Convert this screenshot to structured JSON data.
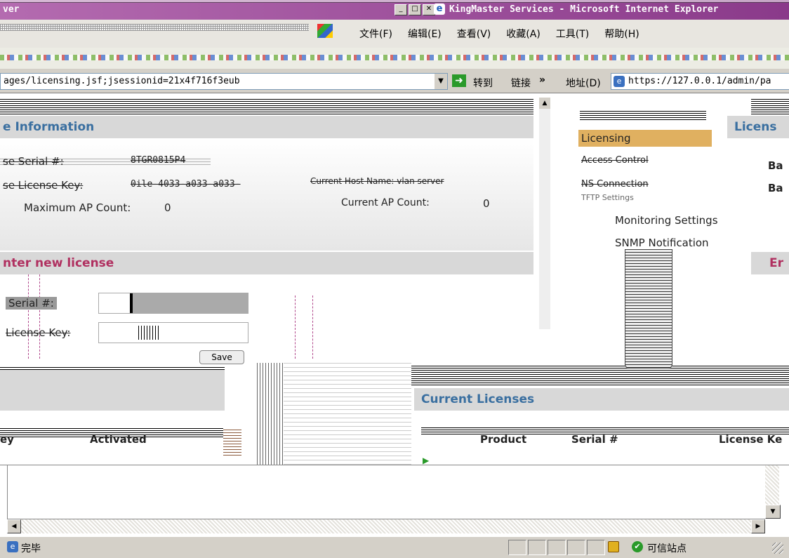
{
  "window": {
    "title": "KingMaster Services - Microsoft Internet Explorer",
    "title_left": "ver",
    "controls": [
      "_",
      "□",
      "✕"
    ]
  },
  "menubar": [
    "文件(F)",
    "编辑(E)",
    "查看(V)",
    "收藏(A)",
    "工具(T)",
    "帮助(H)"
  ],
  "addressbar": {
    "url_left": "ages/licensing.jsf;jsessionid=21x4f716f3eub",
    "go_label": "转到",
    "links_label": "链接",
    "links_chevron": "»",
    "address_label": "地址(D)",
    "url_right": "https://127.0.0.1/admin/pa"
  },
  "left_panel": {
    "section_title": "e Information",
    "serial_label": "se Serial #:",
    "serial_value": "8TGR0815P4",
    "license_key_label": "se License Key:",
    "license_key_value": "0ile-4033-a033-a033-",
    "max_ap_label": "Maximum AP Count:",
    "max_ap_value": "0",
    "current_ap_label": "Current AP Count:",
    "current_ap_value": "0",
    "current_server_text": "Current Host Name: vlan server",
    "enter_title": "nter new license",
    "serial_input_label": "Serial #:",
    "license_key_input_label": "License Key:",
    "save_label": "Save"
  },
  "nav": {
    "items": [
      "Licensing",
      "Access Control",
      "NS Connection",
      "TFTP Settings",
      "Monitoring Settings",
      "SNMP Notification"
    ]
  },
  "right_panel": {
    "license_title": "Licens",
    "ba_1": "Ba",
    "ba_2": "Ba",
    "enter_title": "Er"
  },
  "current_licenses": {
    "title": "Current Licenses",
    "columns": [
      "Product",
      "Serial #",
      "License Ke"
    ],
    "left_columns": [
      "ey",
      "Activated"
    ]
  },
  "statusbar": {
    "status_text": "完毕",
    "zone_text": "可信站点"
  }
}
